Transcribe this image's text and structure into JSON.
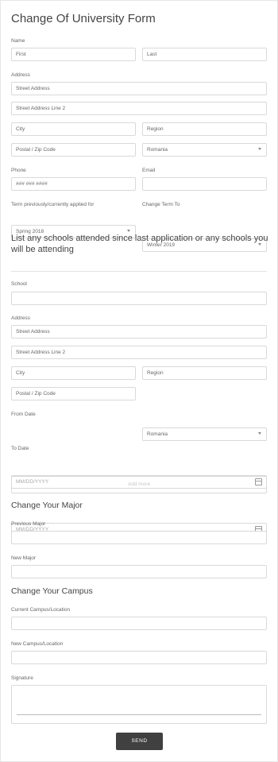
{
  "form": {
    "title": "Change Of University Form",
    "name": {
      "label": "Name",
      "first": "First",
      "last": "Last"
    },
    "address": {
      "label": "Address",
      "street1": "Street Address",
      "street2": "Street Address Line 2",
      "city": "City",
      "region": "Region",
      "postal": "Postal / Zip Code",
      "country": "Romania"
    },
    "phone": {
      "label": "Phone",
      "placeholder": "### ### ####"
    },
    "email": {
      "label": "Email"
    },
    "term_prev": {
      "label": "Term previously/currently applied for",
      "value": "Spring 2018"
    },
    "term_change": {
      "label": "Change Term To",
      "value": "Winter 2019"
    },
    "schools_heading": "List any schools attended since last application or any schools you will be attending",
    "school": {
      "label": "School"
    },
    "address2": {
      "label": "Address",
      "street1": "Street Address",
      "street2": "Street Address Line 2",
      "city": "City",
      "region": "Region",
      "postal": "Postal / Zip Code",
      "country": "Romania"
    },
    "from_date": {
      "label": "From Date",
      "placeholder": "MM/DD/YYYY"
    },
    "to_date": {
      "label": "To Date",
      "placeholder": "MM/DD/YYYY"
    },
    "add_more": "Add more",
    "major_heading": "Change Your Major",
    "prev_major": {
      "label": "Previous Major"
    },
    "new_major": {
      "label": "New Major"
    },
    "campus_heading": "Change Your Campus",
    "current_campus": {
      "label": "Current Campus/Location"
    },
    "new_campus": {
      "label": "New Campus/Location"
    },
    "signature": {
      "label": "Signature"
    },
    "send": "SEND"
  }
}
